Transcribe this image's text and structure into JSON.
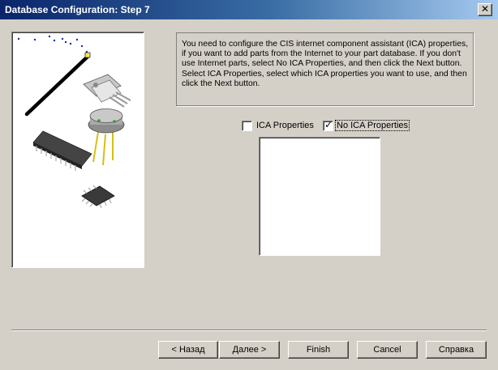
{
  "window": {
    "title": "Database Configuration: Step 7",
    "close_glyph": "✕"
  },
  "info": {
    "text": "You need to configure the CIS internet component assistant (ICA) properties, if you want to add parts from the Internet to your part database. If you don't use Internet parts, select No ICA Properties, and then click the Next button. Select ICA Properties, select which ICA properties you want to use, and then click the Next button."
  },
  "options": {
    "ica": {
      "label": "ICA Properties",
      "checked": false
    },
    "no_ica": {
      "label": "No ICA Properties",
      "checked": true,
      "check_glyph": "✓"
    }
  },
  "buttons": {
    "back": "< Назад",
    "next": "Далее >",
    "finish": "Finish",
    "cancel": "Cancel",
    "help": "Справка"
  },
  "icons": {
    "illustration": "electronic-components-illustration",
    "close": "close-icon",
    "checkmark": "checkmark-icon"
  },
  "colors": {
    "titlebar_start": "#0a246a",
    "titlebar_end": "#a6caf0",
    "dialog_bg": "#d4d0c8"
  }
}
